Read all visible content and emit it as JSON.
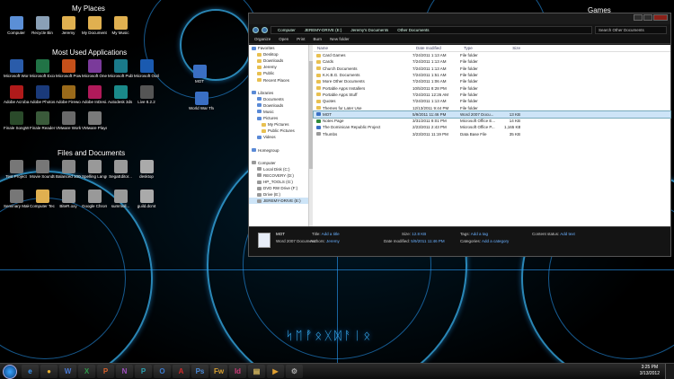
{
  "desktop": {
    "sections": {
      "my_places": "My Places",
      "most_used": "Most Used Applications",
      "files_docs": "Files and Documents",
      "games": "Games"
    },
    "my_places_icons": [
      {
        "label": "Computer",
        "color": "#5b8fd6"
      },
      {
        "label": "Recycle Bin",
        "color": "#8aa0b6"
      },
      {
        "label": "Jeremy",
        "color": "#e0b050"
      },
      {
        "label": "My Documents",
        "color": "#e0b050"
      },
      {
        "label": "My Music",
        "color": "#e0b050"
      }
    ],
    "apps_icons": [
      {
        "label": "Microsoft Word 2010",
        "color": "#2a5caa"
      },
      {
        "label": "Microsoft Excel 2010",
        "color": "#217346"
      },
      {
        "label": "Microsoft PowerPoi...",
        "color": "#c4501a"
      },
      {
        "label": "Microsoft OneNote...",
        "color": "#7a3a9a"
      },
      {
        "label": "Microsoft Publish...",
        "color": "#1a7a8a"
      },
      {
        "label": "Microsoft Outlook 2010",
        "color": "#1a5ab0"
      },
      {
        "label": "Adobe Acrobat...",
        "color": "#b01a1a"
      },
      {
        "label": "Adobe Photoshop...",
        "color": "#1a3a7a"
      },
      {
        "label": "Adobe Fireworks...",
        "color": "#9a6a1a"
      },
      {
        "label": "Adobe InDesi...",
        "color": "#b01a5a"
      },
      {
        "label": "Autodesk 3ds Max 2012 6...",
        "color": "#1a8a8a"
      },
      {
        "label": "Live 8.2.2",
        "color": "#555555"
      },
      {
        "label": "Finale SongWrit...",
        "color": "#2a4a2a"
      },
      {
        "label": "Finale Reader 2011",
        "color": "#3a5a3a"
      },
      {
        "label": "VMware Workstation",
        "color": "#6a6a6a"
      },
      {
        "label": "VMware Player",
        "color": "#7a7a7a"
      }
    ],
    "files_icons": [
      {
        "label": "Test Project",
        "color": "#777777"
      },
      {
        "label": "Movie Soundtrack",
        "color": "#777777"
      },
      {
        "label": "Balanced 10000.dsm",
        "color": "#888888"
      },
      {
        "label": "Spelling Language Spell.lca",
        "color": "#999999"
      },
      {
        "label": "SegaEditor...",
        "color": "#999999"
      },
      {
        "label": "desktop",
        "color": "#aaaaaa"
      },
      {
        "label": "Seminary Make-...",
        "color": "#777777"
      },
      {
        "label": "Computer Technology",
        "color": "#e0b050"
      },
      {
        "label": "BiteR.oxy",
        "color": "#999999"
      },
      {
        "label": "Google Chrom...",
        "color": "#999999"
      },
      {
        "label": "summoll...",
        "color": "#999999"
      },
      {
        "label": "guild.dcmt",
        "color": "#aaaaaa"
      }
    ],
    "middle_icons": [
      {
        "label": "MOT",
        "color": "#3a6fc4"
      },
      {
        "label": "World War Three Research...",
        "color": "#3a6fc4"
      }
    ],
    "watermark_text": "ᛋᛖᚡᛟᚷᛞᚨᛁᛟ"
  },
  "explorer": {
    "breadcrumb": [
      "Computer",
      "JEREMY-DRIVE (E:)",
      "Jeremy's Documents",
      "Other Documents"
    ],
    "search_placeholder": "Search Other Documents",
    "toolbar": {
      "organize": "Organize",
      "open": "Open",
      "print": "Print",
      "burn": "Burn",
      "new_folder": "New folder"
    },
    "nav": [
      {
        "label": "Favorites",
        "icon": "star-icon",
        "sel": false
      },
      {
        "label": "Desktop",
        "icon": "desktop-icon",
        "sel": false
      },
      {
        "label": "Downloads",
        "icon": "folder-icon",
        "sel": false
      },
      {
        "label": "Jeremy",
        "icon": "folder-icon",
        "sel": false
      },
      {
        "label": "Public",
        "icon": "folder-icon",
        "sel": false
      },
      {
        "label": "Recent Places",
        "icon": "folder-icon",
        "sel": false
      },
      {
        "label": "",
        "icon": "",
        "sel": false
      },
      {
        "label": "Libraries",
        "icon": "library-icon",
        "sel": false
      },
      {
        "label": "Documents",
        "icon": "library-icon",
        "sel": false
      },
      {
        "label": "Downloads",
        "icon": "library-icon",
        "sel": false
      },
      {
        "label": "Music",
        "icon": "library-icon",
        "sel": false
      },
      {
        "label": "Pictures",
        "icon": "library-icon",
        "sel": false
      },
      {
        "label": "My Pictures",
        "icon": "folder-icon",
        "sel": false
      },
      {
        "label": "Public Pictures",
        "icon": "folder-icon",
        "sel": false
      },
      {
        "label": "Videos",
        "icon": "library-icon",
        "sel": false
      },
      {
        "label": "",
        "icon": "",
        "sel": false
      },
      {
        "label": "Homegroup",
        "icon": "homegroup-icon",
        "sel": false
      },
      {
        "label": "",
        "icon": "",
        "sel": false
      },
      {
        "label": "Computer",
        "icon": "computer-icon",
        "sel": false
      },
      {
        "label": "Local Disk (C:)",
        "icon": "drive-icon",
        "sel": false
      },
      {
        "label": "RECOVERY (D:)",
        "icon": "drive-icon",
        "sel": false
      },
      {
        "label": "HP_TOOLS (G:)",
        "icon": "drive-icon",
        "sel": false
      },
      {
        "label": "DVD RW Drive (F:)",
        "icon": "drive-icon",
        "sel": false
      },
      {
        "label": "Drive (E:)",
        "icon": "drive-icon",
        "sel": false
      },
      {
        "label": "JEREMY-DRIVE (E:)",
        "icon": "drive-icon",
        "sel": true
      }
    ],
    "columns": {
      "name": "Name",
      "date": "Date modified",
      "type": "Type",
      "size": "Size"
    },
    "files": [
      {
        "name": "Card Games",
        "date": "7/24/2011 1:13 AM",
        "type": "File folder",
        "size": "",
        "kind": "folder"
      },
      {
        "name": "Cards",
        "date": "7/24/2011 1:13 AM",
        "type": "File folder",
        "size": "",
        "kind": "folder"
      },
      {
        "name": "Church Documents",
        "date": "7/24/2011 1:13 AM",
        "type": "File folder",
        "size": "",
        "kind": "folder"
      },
      {
        "name": "K.K.B.G. Documents",
        "date": "7/24/2011 1:51 AM",
        "type": "File folder",
        "size": "",
        "kind": "folder"
      },
      {
        "name": "More Other Documents",
        "date": "7/24/2011 1:06 AM",
        "type": "File folder",
        "size": "",
        "kind": "folder"
      },
      {
        "name": "Portable Apps Installers",
        "date": "10/5/2011 8:28 PM",
        "type": "File folder",
        "size": "",
        "kind": "folder"
      },
      {
        "name": "Portable Apps Stuff",
        "date": "7/24/2011 12:26 AM",
        "type": "File folder",
        "size": "",
        "kind": "folder"
      },
      {
        "name": "Quotes",
        "date": "7/24/2011 1:13 AM",
        "type": "File folder",
        "size": "",
        "kind": "folder"
      },
      {
        "name": "Themes for Later Use",
        "date": "12/13/2011 9:44 PM",
        "type": "File folder",
        "size": "",
        "kind": "folder"
      },
      {
        "name": "MOT",
        "date": "5/9/2011 11:46 PM",
        "type": "Word 2007 Docu...",
        "size": "13 KB",
        "kind": "doc",
        "sel": true
      },
      {
        "name": "Notes Page",
        "date": "3/31/2011 8:01 PM",
        "type": "Microsoft Office E...",
        "size": "14 KB",
        "kind": "xl"
      },
      {
        "name": "The Dominican Republic Project",
        "date": "2/23/2011 2:43 PM",
        "type": "Microsoft Office P...",
        "size": "1,165 KB",
        "kind": "doc"
      },
      {
        "name": "Thumbs",
        "date": "3/23/2011 11:19 PM",
        "type": "Data Base File",
        "size": "35 KB",
        "kind": "db"
      }
    ],
    "details": {
      "name": "MOT",
      "subtitle": "Word 2007 Document",
      "title_label": "Title:",
      "title_value": "Add a title",
      "authors_label": "Authors:",
      "authors_value": "Jeremy",
      "size_label": "Size:",
      "size_value": "12.8 KB",
      "date_label": "Date modified:",
      "date_value": "5/9/2011 11:46 PM",
      "tags_label": "Tags:",
      "tags_value": "Add a tag",
      "categories_label": "Categories:",
      "categories_value": "Add a category",
      "status_label": "Content status:",
      "status_value": "Add text"
    }
  },
  "taskbar": {
    "time": "3:25 PM",
    "date": "3/13/2012",
    "apps": [
      {
        "name": "ie-icon",
        "glyph": "e",
        "color": "#3a9aff"
      },
      {
        "name": "chrome-icon",
        "glyph": "●",
        "color": "#e8b030"
      },
      {
        "name": "word-icon",
        "glyph": "W",
        "color": "#4a7ad6"
      },
      {
        "name": "excel-icon",
        "glyph": "X",
        "color": "#2f9a4a"
      },
      {
        "name": "powerpoint-icon",
        "glyph": "P",
        "color": "#d8602a"
      },
      {
        "name": "onenote-icon",
        "glyph": "N",
        "color": "#a050c0"
      },
      {
        "name": "publisher-icon",
        "glyph": "P",
        "color": "#2aa0b0"
      },
      {
        "name": "outlook-icon",
        "glyph": "O",
        "color": "#3a7ad0"
      },
      {
        "name": "acrobat-icon",
        "glyph": "A",
        "color": "#d02a2a"
      },
      {
        "name": "photoshop-icon",
        "glyph": "Ps",
        "color": "#4a8ad8"
      },
      {
        "name": "fireworks-icon",
        "glyph": "Fw",
        "color": "#d8a030"
      },
      {
        "name": "indesign-icon",
        "glyph": "Id",
        "color": "#d03a7a"
      },
      {
        "name": "explorer-icon",
        "glyph": "▤",
        "color": "#e0c060"
      },
      {
        "name": "media-icon",
        "glyph": "▶",
        "color": "#e0a030"
      },
      {
        "name": "tool-icon",
        "glyph": "⚙",
        "color": "#aaaaaa"
      }
    ]
  }
}
